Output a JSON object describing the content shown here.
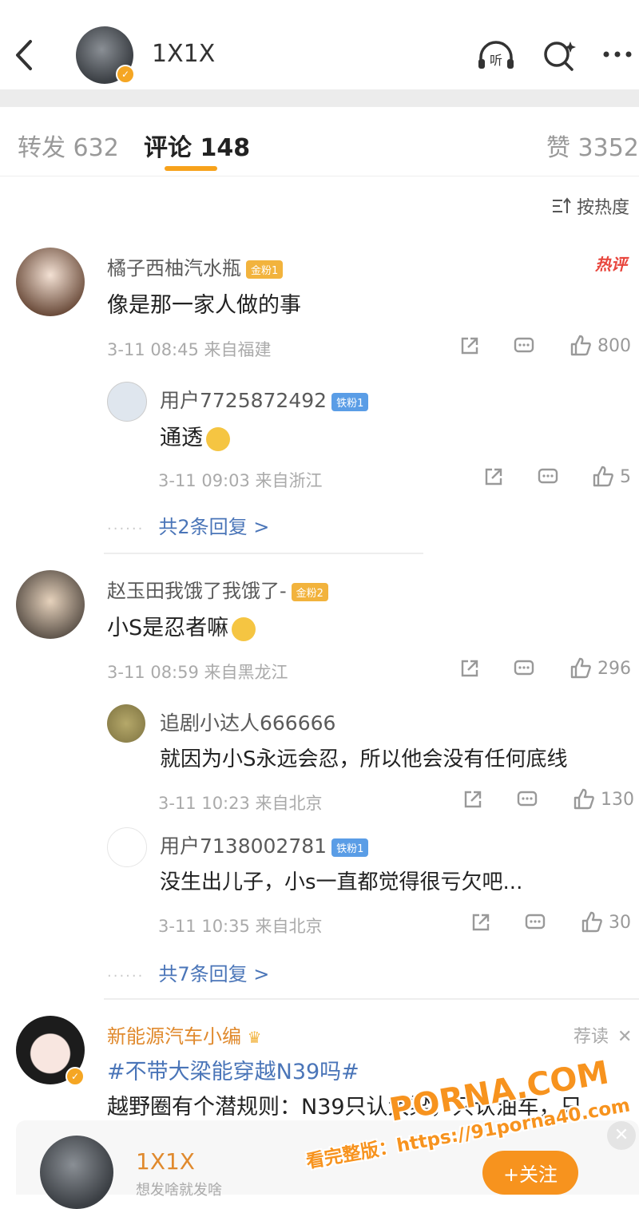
{
  "header": {
    "title": "1X1X",
    "icons": [
      "back-arrow-icon",
      "listen-icon",
      "search-icon",
      "more-icon"
    ],
    "listen_label": "听"
  },
  "tabs": [
    {
      "label": "转发 632"
    },
    {
      "label": "评论 148",
      "active": true
    },
    {
      "label": "赞 3352"
    }
  ],
  "sort_label": "按热度",
  "hot_label": "热评",
  "comments": [
    {
      "name": "橘子西柚汽水瓶",
      "badge": "金粉1",
      "text": "像是那一家人做的事",
      "meta": "3-11 08:45 来自福建",
      "likes": "800",
      "replies": [
        {
          "name": "用户7725872492",
          "badge": "铁粉1",
          "text": "通透",
          "meta": "3-11 09:03 来自浙江",
          "likes": "5"
        }
      ],
      "more": "共2条回复 >"
    },
    {
      "name": "赵玉田我饿了我饿了-",
      "badge": "金粉2",
      "text": "小S是忍者嘛",
      "meta": "3-11 08:59 来自黑龙江",
      "likes": "296",
      "replies": [
        {
          "name": "追剧小达人666666",
          "badge": "",
          "text": "就因为小S永远会忍，所以他会没有任何底线",
          "meta": "3-11 10:23 来自北京",
          "likes": "130"
        },
        {
          "name": "用户7138002781",
          "badge": "铁粉1",
          "text": "没生出儿子，小s一直都觉得很亏欠吧...",
          "meta": "3-11 10:35 来自北京",
          "likes": "30"
        }
      ],
      "more": "共7条回复 >"
    },
    {
      "name": "新能源汽车小编",
      "tag": "荐读",
      "topic": "#不带大梁能穿越N39吗#",
      "text": "越野圈有个潜规则：N39只认大梁，只认油车，只"
    }
  ],
  "bottom": {
    "name": "1X1X",
    "subtitle": "想发啥就发啥",
    "follow_label": "+关注"
  },
  "watermark": {
    "line1": "PORNA.COM",
    "line2": "看完整版：https://91porna40.com"
  },
  "colors": {
    "accent": "#f7931e",
    "link": "#4a75b8",
    "hot": "#e8453c"
  }
}
